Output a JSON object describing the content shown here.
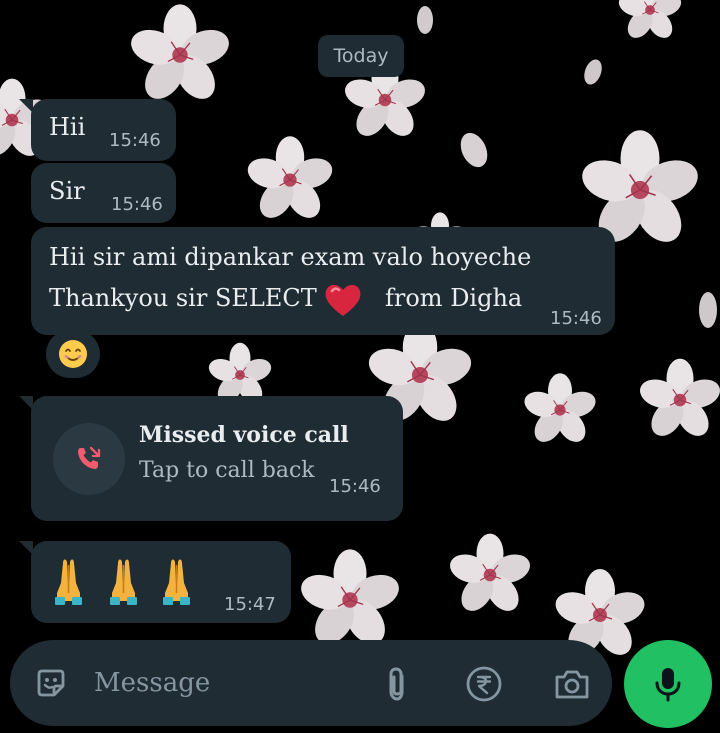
{
  "date_chip": "Today",
  "messages": [
    {
      "text": "Hii",
      "time": "15:46"
    },
    {
      "text": "Sir",
      "time": "15:46"
    },
    {
      "lines": [
        "Hii sir ami dipankar exam valo hoyeche",
        "Thankyou sir  SELECT",
        "from Digha"
      ],
      "time": "15:46"
    },
    {
      "emoji": "smiling-face-emoji"
    },
    {
      "call_title": "Missed voice call",
      "call_subtitle": "Tap to call back",
      "time": "15:46"
    },
    {
      "emoji": "folded-hands-x3",
      "time": "15:47"
    }
  ],
  "composer": {
    "placeholder": "Message",
    "icons": [
      "sticker-icon",
      "attach-icon",
      "rupee-icon",
      "camera-icon"
    ]
  },
  "mic_icon": "mic-icon",
  "colors": {
    "bubble": "#1f2c34",
    "accent": "#21c063",
    "missed_call": "#f15c6d",
    "muted": "#aebac1"
  }
}
